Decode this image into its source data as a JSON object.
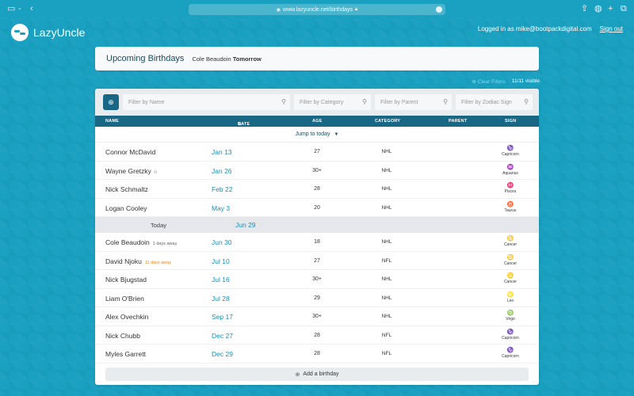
{
  "browser": {
    "url": "www.lazyuncle.net/birthdays"
  },
  "app": {
    "logo_text": "LazyUncle",
    "logged_in_text": "Logged in as mike@bootpackdigital.com",
    "sign_out": "Sign out"
  },
  "upcoming": {
    "title": "Upcoming Birthdays",
    "next_name": "Cole Beaudoin",
    "next_when": "Tomorrow"
  },
  "filters": {
    "clear_label": "Clear Filters",
    "visible_count": "11/11 visible",
    "name_placeholder": "Filter by Name",
    "category_placeholder": "Filter by Category",
    "parent_placeholder": "Filter by Parent",
    "sign_placeholder": "Filter by Zodiac Sign"
  },
  "table": {
    "headers": {
      "name": "NAME",
      "date": "DATE",
      "age": "AGE",
      "category": "CATEGORY",
      "parent": "PARENT",
      "sign": "SIGN"
    },
    "jump_label": "Jump to today",
    "today_label": "Today",
    "today_date": "Jun 29",
    "rows_before": [
      {
        "name": "Connor McDavid",
        "date": "Jan 13",
        "age": "27",
        "category": "NHL",
        "sign": "Capricorn",
        "glyph": "♑"
      },
      {
        "name": "Wayne Gretzky",
        "date": "Jan 26",
        "age": "30+",
        "category": "NHL",
        "sign": "Aquarius",
        "glyph": "♒"
      },
      {
        "name": "Nick Schmaltz",
        "date": "Feb 22",
        "age": "28",
        "category": "NHL",
        "sign": "Pisces",
        "glyph": "♓"
      },
      {
        "name": "Logan Cooley",
        "date": "May 3",
        "age": "20",
        "category": "NHL",
        "sign": "Taurus",
        "glyph": "♉"
      }
    ],
    "rows_after": [
      {
        "name": "Cole Beaudoin",
        "away": "1 days away",
        "date": "Jun 30",
        "age": "18",
        "category": "NHL",
        "sign": "Cancer",
        "glyph": "♋"
      },
      {
        "name": "David Njoku",
        "away": "11 days away",
        "date": "Jul 10",
        "age": "27",
        "category": "NFL",
        "sign": "Cancer",
        "glyph": "♋"
      },
      {
        "name": "Nick Bjugstad",
        "date": "Jul 16",
        "age": "30+",
        "category": "NHL",
        "sign": "Cancer",
        "glyph": "♋"
      },
      {
        "name": "Liam O'Brien",
        "date": "Jul 28",
        "age": "29",
        "category": "NHL",
        "sign": "Leo",
        "glyph": "♌"
      },
      {
        "name": "Alex Ovechkin",
        "date": "Sep 17",
        "age": "30+",
        "category": "NHL",
        "sign": "Virgo",
        "glyph": "♍"
      },
      {
        "name": "Nick Chubb",
        "date": "Dec 27",
        "age": "28",
        "category": "NFL",
        "sign": "Capricorn",
        "glyph": "♑"
      },
      {
        "name": "Myles Garrett",
        "date": "Dec 29",
        "age": "28",
        "category": "NFL",
        "sign": "Capricorn",
        "glyph": "♑"
      }
    ],
    "add_label": "Add a birthday"
  }
}
